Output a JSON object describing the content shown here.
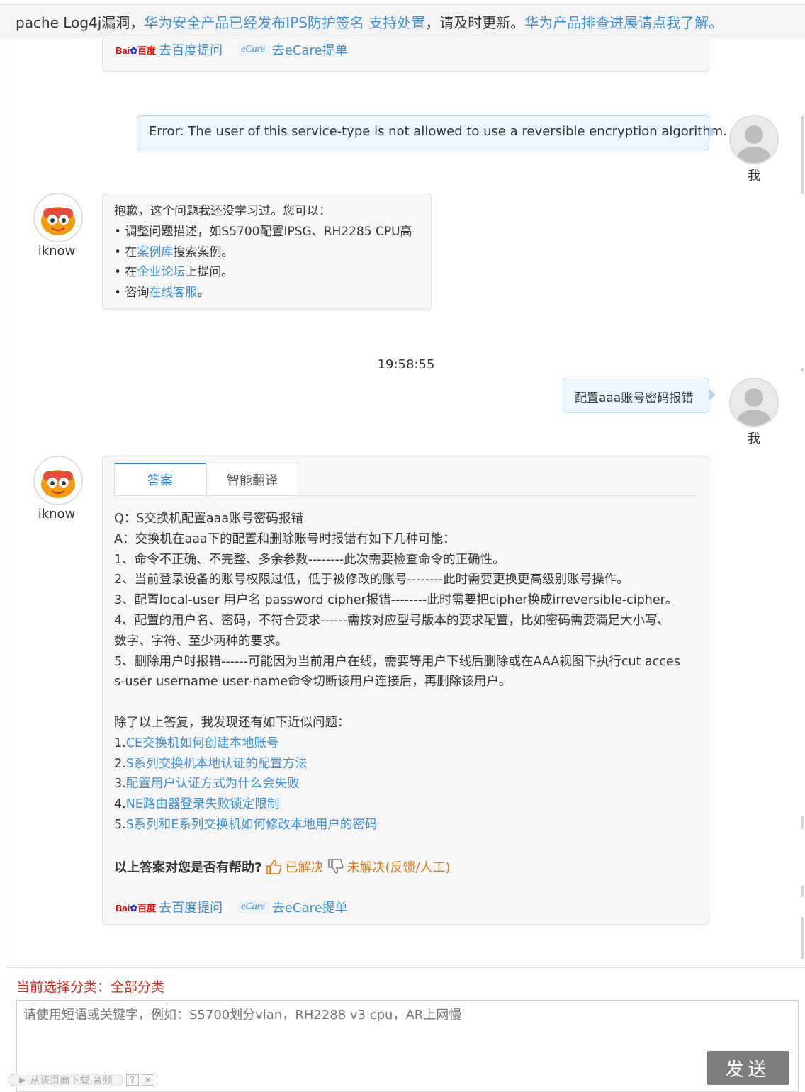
{
  "notice": {
    "prefix": "pache Log4j漏洞，",
    "link1": "华为安全产品已经发布IPS防护签名 支持处置",
    "middle": "，请及时更新。",
    "link2": "华为产品排查进展请点我了解。"
  },
  "askbar": {
    "baidu_logo": "Bai百度",
    "baidu_label": "去百度提问",
    "ecare_logo": "eCare",
    "ecare_label": "去eCare提单"
  },
  "messages": {
    "user1": "Error: The user of this service-type is not allowed to use a reversible encryption algorithm.",
    "user_name": "我",
    "bot_name": "iknow",
    "bot1": {
      "intro": "抱歉，这个问题我还没学习过。您可以：",
      "tip1": "• 调整问题描述，如S5700配置IPSG、RH2285 CPU高",
      "tip2_pre": "• 在",
      "tip2_link": "案例库",
      "tip2_post": "搜索案例。",
      "tip3_pre": "• 在",
      "tip3_link": "企业论坛",
      "tip3_post": "上提问。",
      "tip4_pre": "• 咨询",
      "tip4_link": "在线客服",
      "tip4_post": "。"
    },
    "time": "19:58:55",
    "user2": "配置aaa账号密码报错",
    "bot2": {
      "tabs": [
        "答案",
        "智能翻译"
      ],
      "lines": [
        "Q：S交换机配置aaa账号密码报错",
        "A：交换机在aaa下的配置和删除账号时报错有如下几种可能：",
        "1、命令不正确、不完整、多余参数--------此次需要检查命令的正确性。",
        "2、当前登录设备的账号权限过低，低于被修改的账号--------此时需要更换更高级别账号操作。",
        "3、配置local-user 用户名 password cipher报错--------此时需要把cipher换成irreversible-cipher。",
        "4、配置的用户名、密码，不符合要求------需按对应型号版本的要求配置，比如密码需要满足大小写、",
        "数字、字符、至少两种的要求。",
        "5、删除用户时报错------可能因为当前用户在线，需要等用户下线后删除或在AAA视图下执行cut acces",
        "s-user username user-name命令切断该用户连接后，再删除该用户。"
      ],
      "similar_intro": "除了以上答复，我发现还有如下近似问题：",
      "similar": [
        {
          "num": "1.",
          "text": "CE交换机如何创建本地账号"
        },
        {
          "num": "2.",
          "text": "S系列交换机本地认证的配置方法"
        },
        {
          "num": "3.",
          "text": "配置用户认证方式为什么会失败"
        },
        {
          "num": "4.",
          "text": "NE路由器登录失败锁定限制"
        },
        {
          "num": "5.",
          "text": "S系列和E系列交换机如何修改本地用户的密码"
        }
      ],
      "feedback_q": "以上答案对您是否有帮助?",
      "solved": "已解决",
      "unsolved": "未解决(反馈/人工)"
    }
  },
  "bottom": {
    "category": "当前选择分类：全部分类",
    "placeholder": "请使用短语或关键字，例如：S5700划分vlan，RH2288 v3 cpu，AR上网慢",
    "send": "发送",
    "download": "从该页面下载 音频",
    "help": "?",
    "close": "✕"
  },
  "colors": {
    "link": "#3d8fd9",
    "accent_red": "#d9261c",
    "feedback_orange": "#e07b18",
    "send_bg": "#7d7d7d"
  }
}
